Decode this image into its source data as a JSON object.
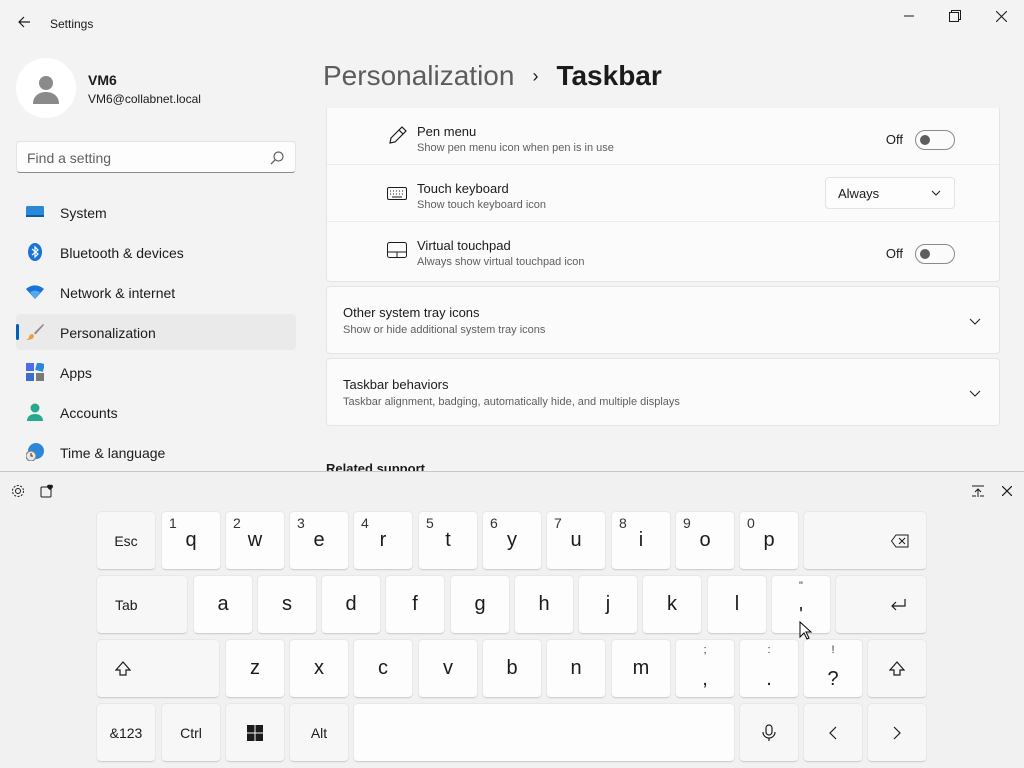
{
  "window": {
    "title": "Settings"
  },
  "profile": {
    "name": "VM6",
    "email": "VM6@collabnet.local"
  },
  "search": {
    "placeholder": "Find a setting"
  },
  "sidebar": {
    "items": [
      {
        "label": "System",
        "icon": "system-icon",
        "active": false
      },
      {
        "label": "Bluetooth & devices",
        "icon": "bluetooth-icon",
        "active": false
      },
      {
        "label": "Network & internet",
        "icon": "wifi-icon",
        "active": false
      },
      {
        "label": "Personalization",
        "icon": "brush-icon",
        "active": true
      },
      {
        "label": "Apps",
        "icon": "apps-icon",
        "active": false
      },
      {
        "label": "Accounts",
        "icon": "person-icon",
        "active": false
      },
      {
        "label": "Time & language",
        "icon": "globe-clock-icon",
        "active": false
      }
    ]
  },
  "breadcrumb": {
    "parent": "Personalization",
    "current": "Taskbar"
  },
  "settings": {
    "pen_menu": {
      "title": "Pen menu",
      "desc": "Show pen menu icon when pen is in use",
      "state": "Off"
    },
    "touch_keyboard": {
      "title": "Touch keyboard",
      "desc": "Show touch keyboard icon",
      "value": "Always"
    },
    "virtual_touchpad": {
      "title": "Virtual touchpad",
      "desc": "Always show virtual touchpad icon",
      "state": "Off"
    },
    "other_tray": {
      "title": "Other system tray icons",
      "desc": "Show or hide additional system tray icons"
    },
    "behaviors": {
      "title": "Taskbar behaviors",
      "desc": "Taskbar alignment, badging, automatically hide, and multiple displays"
    }
  },
  "related": {
    "label": "Related support"
  },
  "keyboard": {
    "row1": [
      {
        "main": "Esc",
        "fn": true
      },
      {
        "main": "q",
        "num": "1"
      },
      {
        "main": "w",
        "num": "2"
      },
      {
        "main": "e",
        "num": "3"
      },
      {
        "main": "r",
        "num": "4"
      },
      {
        "main": "t",
        "num": "5"
      },
      {
        "main": "y",
        "num": "6"
      },
      {
        "main": "u",
        "num": "7"
      },
      {
        "main": "i",
        "num": "8"
      },
      {
        "main": "o",
        "num": "9"
      },
      {
        "main": "p",
        "num": "0"
      }
    ],
    "row2": [
      {
        "main": "Tab",
        "fn": true
      },
      {
        "main": "a"
      },
      {
        "main": "s"
      },
      {
        "main": "d"
      },
      {
        "main": "f"
      },
      {
        "main": "g"
      },
      {
        "main": "h"
      },
      {
        "main": "j"
      },
      {
        "main": "k"
      },
      {
        "main": "l"
      },
      {
        "main": "'",
        "sub": "\""
      }
    ],
    "row3": [
      {
        "main": "z"
      },
      {
        "main": "x"
      },
      {
        "main": "c"
      },
      {
        "main": "v"
      },
      {
        "main": "b"
      },
      {
        "main": "n"
      },
      {
        "main": "m"
      },
      {
        "main": ",",
        "sub": ";"
      },
      {
        "main": ".",
        "sub": ":"
      },
      {
        "main": "?",
        "sub": "!"
      }
    ],
    "row4": {
      "symbols": "&123",
      "ctrl": "Ctrl",
      "alt": "Alt"
    }
  },
  "colors": {
    "accent": "#005fb8",
    "background": "#f3f3f3",
    "card": "#fbfbfb"
  }
}
